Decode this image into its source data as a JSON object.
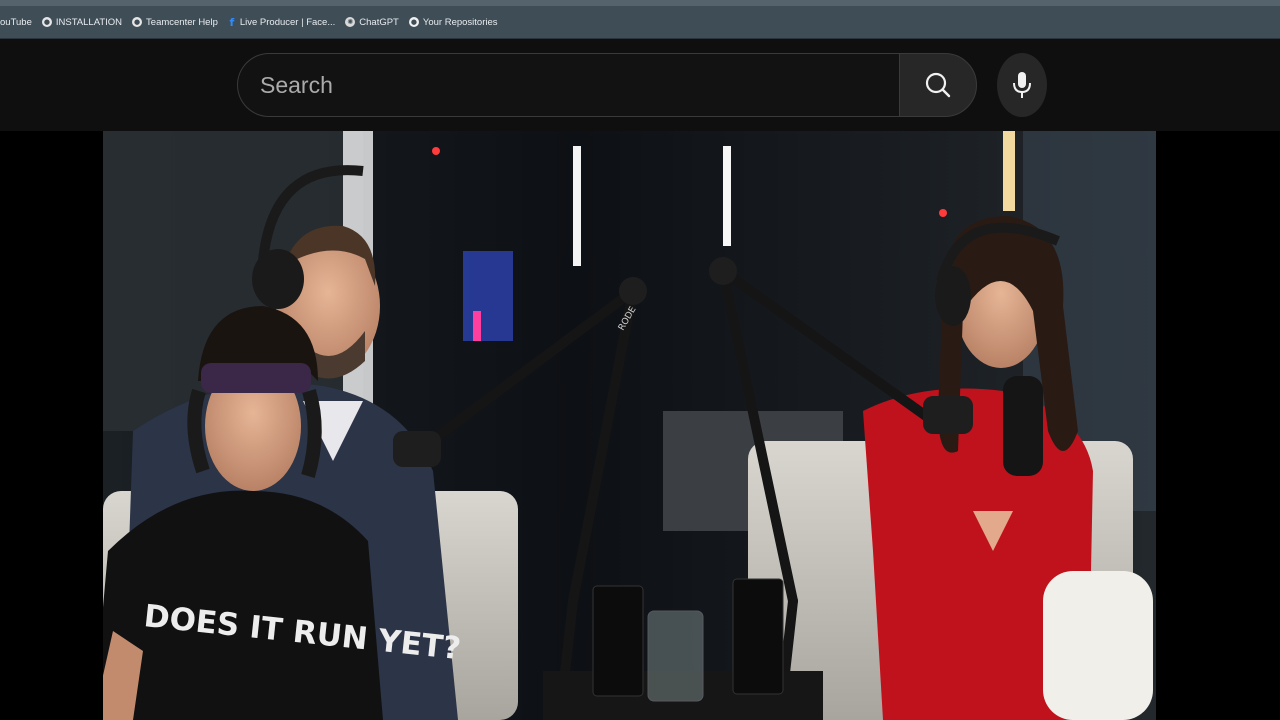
{
  "bookmarks": [
    {
      "label": "ouTube",
      "icon": "youtube-icon"
    },
    {
      "label": "INSTALLATION",
      "icon": "site-icon"
    },
    {
      "label": "Teamcenter Help",
      "icon": "site-icon"
    },
    {
      "label": "Live Producer | Face...",
      "icon": "facebook-icon"
    },
    {
      "label": "ChatGPT",
      "icon": "chatgpt-icon"
    },
    {
      "label": "Your Repositories",
      "icon": "github-icon"
    }
  ],
  "search": {
    "placeholder": "Search",
    "button_icon": "search-icon",
    "voice_icon": "microphone-icon"
  },
  "video": {
    "shirt_text_line1": "DOES IT RUN YET?",
    "mic_brand": "RODE"
  },
  "colors": {
    "bookmark_bar": "#3f4d57",
    "masthead": "#0f0f0f",
    "search_button": "#272727",
    "dress_red": "#c0121c"
  }
}
